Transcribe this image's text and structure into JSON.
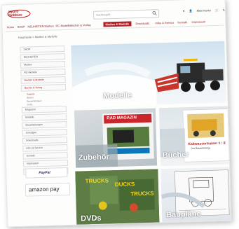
{
  "header": {
    "logo_text": "Hydro Hobbies",
    "search_placeholder": "Suchbegriff...",
    "icons": [
      "heart-icon",
      "user-icon",
      "cart-icon"
    ],
    "account_label": "Mein Konto",
    "cart_label": "0,00 €"
  },
  "nav": {
    "items": [
      {
        "label": "Home"
      },
      {
        "label": "SHOP"
      },
      {
        "label": "NEUHEITEN"
      },
      {
        "label": "Marken"
      },
      {
        "label": "RC-Modelle"
      },
      {
        "label": "Bücher & Verlag"
      },
      {
        "label": "Medien & Modelle"
      },
      {
        "label": "Downloads"
      },
      {
        "label": "Infos & Service"
      },
      {
        "label": "Kontakt"
      },
      {
        "label": "Impressum"
      }
    ]
  },
  "breadcrumb": {
    "home": "Hauptseite",
    "separator": ">",
    "current": "Medien & Modelle"
  },
  "sidebar": {
    "items": [
      {
        "label": "SHOP"
      },
      {
        "label": "NEUHEITEN"
      },
      {
        "label": "Marken"
      },
      {
        "label": "RC-Modelle"
      },
      {
        "label": "Medien & Modelle"
      },
      {
        "label": "Bücher & Verlag"
      }
    ],
    "subitems": [
      {
        "label": "Zubehör"
      },
      {
        "label": "Bücher"
      },
      {
        "label": "Bauanleitungen"
      },
      {
        "label": "DVDs"
      },
      {
        "label": "Magazine"
      },
      {
        "label": "Modelle"
      },
      {
        "label": "Bauanleitungen"
      },
      {
        "label": "Sonstiges"
      }
    ],
    "more_items": [
      {
        "label": "Downloads"
      },
      {
        "label": "Infos & Service"
      },
      {
        "label": "Kontakt"
      },
      {
        "label": "Impressum"
      },
      {
        "label": "Datenschutz"
      }
    ],
    "paypal_label": "PayPal",
    "amazon_label": "amazon pay"
  },
  "tiles": {
    "hero_label": "Modelle",
    "zubehoer_label": "Zubehör",
    "buecher_label": "Bücher",
    "dvds_label": "DVDs",
    "bauplaene_label": "Baupläne",
    "magazine_text": "RAD MAGAZIN",
    "book_title": "Kaltwassertrainer 1 : 8",
    "book_subtitle": "Der Bauanleitung",
    "dvd_text_1": "TRUCKS",
    "dvd_text_2": "DUCKS",
    "dvd_text_3": "TRUCKS"
  },
  "colors": {
    "accent": "#b02024",
    "link": "#8a1a1d"
  }
}
